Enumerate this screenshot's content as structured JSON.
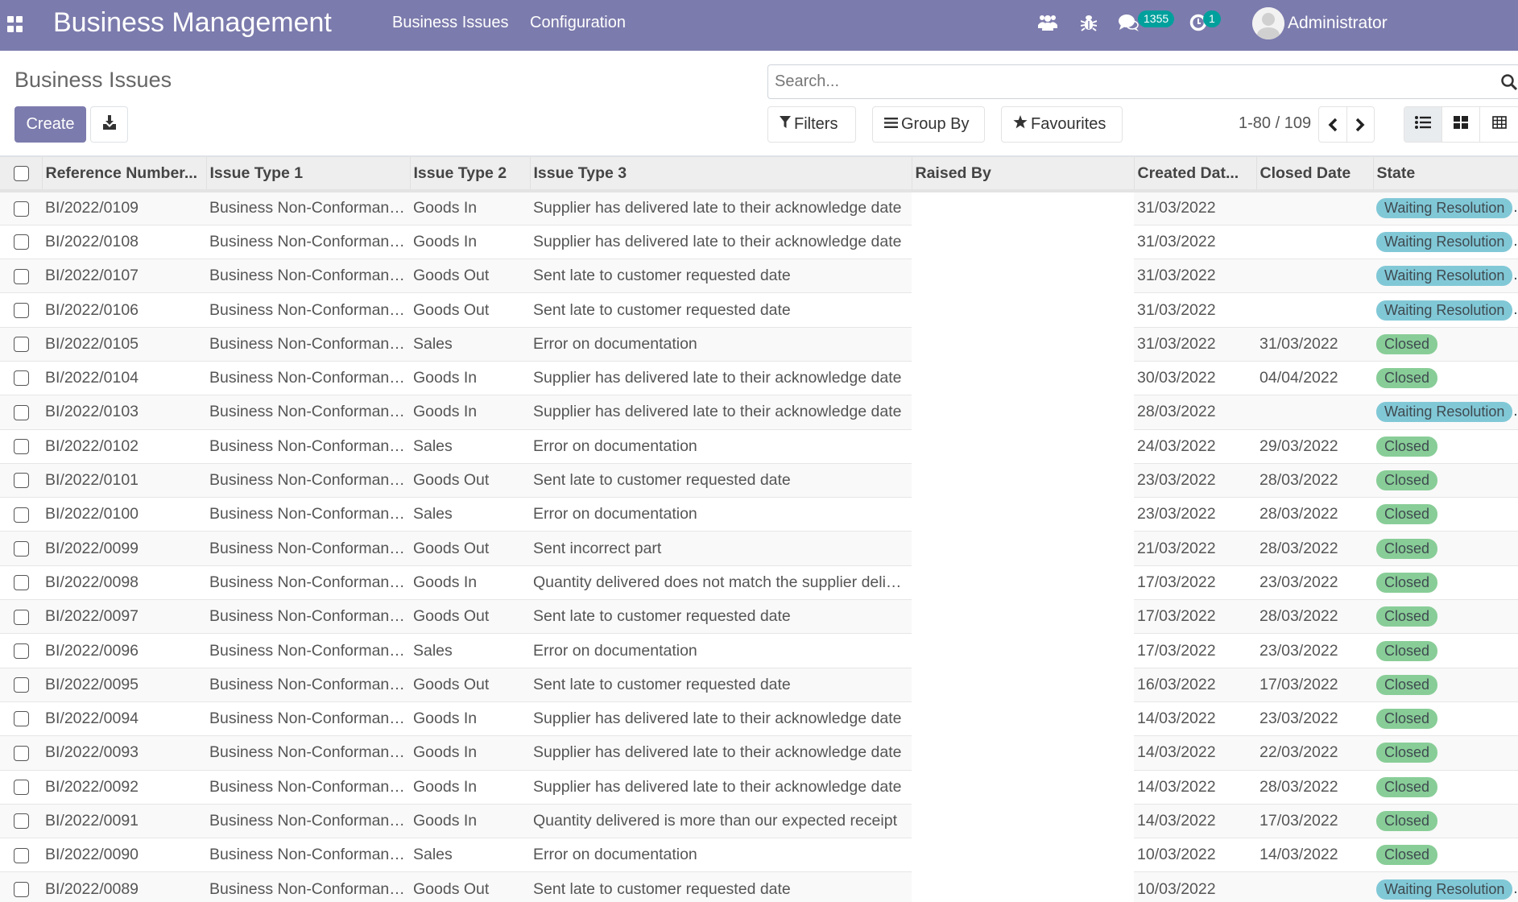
{
  "navbar": {
    "app_title": "Business Management",
    "menu": [
      "Business Issues",
      "Configuration"
    ],
    "icons": {
      "apps": "apps-grid-icon",
      "team": "users-icon",
      "debug": "bug-icon",
      "messages": "chat-icon",
      "activities": "clock-icon"
    },
    "messages_count": "1355",
    "activities_count": "1",
    "user_name": "Administrator",
    "bg_color": "#7c7bad",
    "badge_color": "#00a09d"
  },
  "control_panel": {
    "page_title": "Business Issues",
    "create_label": "Create",
    "download_icon": "download-icon",
    "search_placeholder": "Search...",
    "filters_label": "Filters",
    "group_by_label": "Group By",
    "favourites_label": "Favourites",
    "pager": "1-80 / 109",
    "views": [
      "list",
      "kanban",
      "pivot"
    ],
    "active_view": "list"
  },
  "table": {
    "columns": [
      "Reference Number...",
      "Issue Type 1",
      "Issue Type 2",
      "Issue Type 3",
      "Raised By",
      "Created Dat...",
      "Closed Date",
      "State"
    ],
    "rows": [
      {
        "ref": "BI/2022/0109",
        "type1": "Business Non-Conforman…",
        "type2": "Goods In",
        "type3": "Supplier has delivered late to their acknowledge date",
        "raised_by": "",
        "created": "31/03/2022",
        "closed": "",
        "state": "Waiting Resolution"
      },
      {
        "ref": "BI/2022/0108",
        "type1": "Business Non-Conforman…",
        "type2": "Goods In",
        "type3": "Supplier has delivered late to their acknowledge date",
        "raised_by": "",
        "created": "31/03/2022",
        "closed": "",
        "state": "Waiting Resolution"
      },
      {
        "ref": "BI/2022/0107",
        "type1": "Business Non-Conforman…",
        "type2": "Goods Out",
        "type3": "Sent late to customer requested date",
        "raised_by": "",
        "created": "31/03/2022",
        "closed": "",
        "state": "Waiting Resolution"
      },
      {
        "ref": "BI/2022/0106",
        "type1": "Business Non-Conforman…",
        "type2": "Goods Out",
        "type3": "Sent late to customer requested date",
        "raised_by": "",
        "created": "31/03/2022",
        "closed": "",
        "state": "Waiting Resolution"
      },
      {
        "ref": "BI/2022/0105",
        "type1": "Business Non-Conforman…",
        "type2": "Sales",
        "type3": "Error on documentation",
        "raised_by": "",
        "created": "31/03/2022",
        "closed": "31/03/2022",
        "state": "Closed"
      },
      {
        "ref": "BI/2022/0104",
        "type1": "Business Non-Conforman…",
        "type2": "Goods In",
        "type3": "Supplier has delivered late to their acknowledge date",
        "raised_by": "",
        "created": "30/03/2022",
        "closed": "04/04/2022",
        "state": "Closed"
      },
      {
        "ref": "BI/2022/0103",
        "type1": "Business Non-Conforman…",
        "type2": "Goods In",
        "type3": "Supplier has delivered late to their acknowledge date",
        "raised_by": "",
        "created": "28/03/2022",
        "closed": "",
        "state": "Waiting Resolution"
      },
      {
        "ref": "BI/2022/0102",
        "type1": "Business Non-Conforman…",
        "type2": "Sales",
        "type3": "Error on documentation",
        "raised_by": "",
        "created": "24/03/2022",
        "closed": "29/03/2022",
        "state": "Closed"
      },
      {
        "ref": "BI/2022/0101",
        "type1": "Business Non-Conforman…",
        "type2": "Goods Out",
        "type3": "Sent late to customer requested date",
        "raised_by": "",
        "created": "23/03/2022",
        "closed": "28/03/2022",
        "state": "Closed"
      },
      {
        "ref": "BI/2022/0100",
        "type1": "Business Non-Conforman…",
        "type2": "Sales",
        "type3": "Error on documentation",
        "raised_by": "",
        "created": "23/03/2022",
        "closed": "28/03/2022",
        "state": "Closed"
      },
      {
        "ref": "BI/2022/0099",
        "type1": "Business Non-Conforman…",
        "type2": "Goods Out",
        "type3": "Sent incorrect part",
        "raised_by": "",
        "created": "21/03/2022",
        "closed": "28/03/2022",
        "state": "Closed"
      },
      {
        "ref": "BI/2022/0098",
        "type1": "Business Non-Conforman…",
        "type2": "Goods In",
        "type3": "Quantity delivered does not match the supplier deli…",
        "raised_by": "",
        "created": "17/03/2022",
        "closed": "23/03/2022",
        "state": "Closed"
      },
      {
        "ref": "BI/2022/0097",
        "type1": "Business Non-Conforman…",
        "type2": "Goods Out",
        "type3": "Sent late to customer requested date",
        "raised_by": "",
        "created": "17/03/2022",
        "closed": "28/03/2022",
        "state": "Closed"
      },
      {
        "ref": "BI/2022/0096",
        "type1": "Business Non-Conforman…",
        "type2": "Sales",
        "type3": "Error on documentation",
        "raised_by": "",
        "created": "17/03/2022",
        "closed": "23/03/2022",
        "state": "Closed"
      },
      {
        "ref": "BI/2022/0095",
        "type1": "Business Non-Conforman…",
        "type2": "Goods Out",
        "type3": "Sent late to customer requested date",
        "raised_by": "",
        "created": "16/03/2022",
        "closed": "17/03/2022",
        "state": "Closed"
      },
      {
        "ref": "BI/2022/0094",
        "type1": "Business Non-Conforman…",
        "type2": "Goods In",
        "type3": "Supplier has delivered late to their acknowledge date",
        "raised_by": "",
        "created": "14/03/2022",
        "closed": "23/03/2022",
        "state": "Closed"
      },
      {
        "ref": "BI/2022/0093",
        "type1": "Business Non-Conforman…",
        "type2": "Goods In",
        "type3": "Supplier has delivered late to their acknowledge date",
        "raised_by": "",
        "created": "14/03/2022",
        "closed": "22/03/2022",
        "state": "Closed"
      },
      {
        "ref": "BI/2022/0092",
        "type1": "Business Non-Conforman…",
        "type2": "Goods In",
        "type3": "Supplier has delivered late to their acknowledge date",
        "raised_by": "",
        "created": "14/03/2022",
        "closed": "28/03/2022",
        "state": "Closed"
      },
      {
        "ref": "BI/2022/0091",
        "type1": "Business Non-Conforman…",
        "type2": "Goods In",
        "type3": "Quantity delivered is more than our expected receipt",
        "raised_by": "",
        "created": "14/03/2022",
        "closed": "17/03/2022",
        "state": "Closed"
      },
      {
        "ref": "BI/2022/0090",
        "type1": "Business Non-Conforman…",
        "type2": "Sales",
        "type3": "Error on documentation",
        "raised_by": "",
        "created": "10/03/2022",
        "closed": "14/03/2022",
        "state": "Closed"
      },
      {
        "ref": "BI/2022/0089",
        "type1": "Business Non-Conforman…",
        "type2": "Goods Out",
        "type3": "Sent late to customer requested date",
        "raised_by": "",
        "created": "10/03/2022",
        "closed": "",
        "state": "Waiting Resolution"
      }
    ],
    "state_colors": {
      "Waiting Resolution": "#81c8d7",
      "Closed": "#88cd97"
    }
  }
}
